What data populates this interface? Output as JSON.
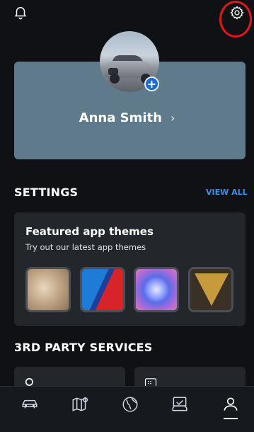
{
  "top_bar": {
    "bell_icon": "bell-icon",
    "settings_icon": "gear-icon"
  },
  "profile": {
    "name": "Anna Smith",
    "chevron": "›",
    "add_icon": "+"
  },
  "settings": {
    "title": "SETTINGS",
    "view_all": "VIEW ALL"
  },
  "themes": {
    "title": "Featured app themes",
    "subtitle": "Try out our latest app themes"
  },
  "third_party": {
    "title": "3RD PARTY SERVICES"
  },
  "bottom_nav": {
    "items": [
      "car-icon",
      "map-icon",
      "globe-icon",
      "vehicle-service-icon",
      "profile-icon"
    ],
    "active": "profile-icon"
  },
  "colors": {
    "accent": "#1c69d4",
    "link": "#3d8fe6",
    "highlight": "#e4141b",
    "card": "#5f7a8a"
  }
}
